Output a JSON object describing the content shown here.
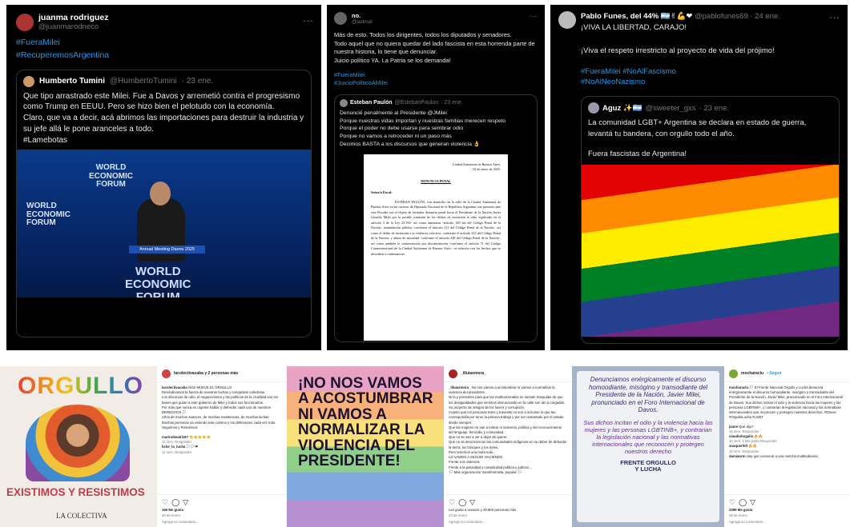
{
  "t1": {
    "name": "juanma rodriguez",
    "handle": "@juanmarodneco",
    "tags": [
      "#FueraMilei",
      "#RecuperemosArgentina"
    ],
    "q": {
      "name": "Humberto Tumini",
      "handle": "@HumbertoTumini",
      "date": "· 23 ene.",
      "text": "Que tipo arrastrado este Milei. Fue a Davos y arremetió contra el progresismo como Trump en EEUU. Pero se hizo bien el pelotudo con la economía.\nClaro, que va a decir, acá abrimos las importaciones para destruir la industria y su jefe allá le pone aranceles a todo.\n#Lamebotas",
      "img": {
        "wef1": "WORLD\nECONOMIC\nFORUM",
        "wef2": "WORLD\nECONOMIC\nFORUM",
        "wef3": "WORLD\nECONOMIC\nFORUM",
        "banner": "Annual Meeting Davos 2025"
      }
    }
  },
  "t2": {
    "name": "no.",
    "handle": "@iadmal",
    "text": "Más de esto. Todos los dirigentes, todos los diputados y senadores.\nTodo aquel que no quiera quedar del lado fascista en esta horrenda parte de nuestra historia, lo tiene que denunciar.\nJuicio político YA. La Patria se los demanda!",
    "tags": [
      "#FueraMilei",
      "#JuicioPoliticoAMilei"
    ],
    "q": {
      "name": "Esteban Paulón",
      "handle": "@EstebanPaulon",
      "date": "· 23 ene.",
      "text": "Denuncié penalmente al Presidente @JMilei\nPorque nuestras vidas importan y nuestras familias merecen respeto\nPorque el poder no debe usarse para sembrar odio\nPorque no vamos a retroceder ni un paso más\nDecimos BASTA a los discursos que generan violencia 👌",
      "doc": {
        "place": "Ciudad Autónoma de Buenos Aires,\n23 de enero de 2025.",
        "title": "DENUNCIA PENAL",
        "salute": "Señor/a Fiscal:",
        "body": "ESTEBAN PAULÓN, con domicilio en la calle de la Ciudad Autónoma de Buenos Aires en mi carácter de Diputado Nacional de la República Argentina, me presento ante esta Fiscalía con el objeto de formular denuncia penal hacia el Presidente de la Nación Javier Gerardo Milei por la posible comisión de los delitos de incitación al odio -tipificado en el artículo 3 de la Ley 23.592- así como amenazas -artículo 149 bis del Código Penal de la Nación-, intimidación pública -conforme el artículo 211 del Código Penal de la Nación-, así como el delito de incitación a la violencia colectiva -conforme el artículo 212 del Código Penal de la Nación- y abuso de autoridad -conforme el artículo 248 del Código Penal de la Nación-, así como también la contravención por discriminación -conforme el artículo 71 del Código Contravencional de la Ciudad Autónoma de Buenos Aires-, en relación con los hechos que se describen a continuación."
      }
    }
  },
  "t3": {
    "name": "Pablo Funes, del 44% 🇦🇷✌💪❤",
    "handle": "@pablofunes69",
    "date": "· 24 ene.",
    "l1": "¡VIVA LA LIBERTAD, CARAJO!",
    "l2": "¡Viva el respeto irrestricto al proyecto de vida del prójimo!",
    "tags": [
      "#FueraMilei #NoAlFascismo",
      "#NoAlNeoNazismo"
    ],
    "q": {
      "name": "Aguz ✨🇦🇷",
      "handle": "@sweeter_gxs",
      "date": "· 23 ene.",
      "text": "La comunidad LGBT+ Argentina se declara en estado de guerra, levantá tu bandera, con orgullo todo el año.",
      "text2": "Fuera fascistas de Argentina!"
    }
  },
  "ig1": {
    "title": "ORGULLO",
    "sub": "EXISTIMOS Y RESISTIMOS",
    "brand": "LA COLECTIVA"
  },
  "ig1r": {
    "user": "lacolectivacaba y 2 personas más",
    "cap_user": "lacolectivacaba",
    "cap": "NOS MUEVE EL ORGULLO",
    "body": [
      "Reivindicamos la fuerza de nuestras luchas y conquistas colectivas.",
      "Los discursos de odio, el negacionismo y las políticas de la crueldad son los bases que guían a este gobierno de Milei y todos sus funcionarios.",
      "Por más que nunca es urgente hablar y defender cada uno de nuestros DERECHOS 🏳",
      "Años de muchos avances, de muchas resistencias, de muchas luchas.",
      "Muchas personas ya viviendo este camino y los defensores cada vez más.",
      "Seguimos y Resistimos"
    ],
    "c1u": "marinobeatriz67",
    "c1": "👏👏👏👏👏",
    "c1m": "11 sem.  Responder",
    "c2u": "liche_la_lucha",
    "c2": "🏳🏳❤",
    "c2m": "11 sem.  Responder",
    "likes": "166 Me gusta",
    "ago": "28 de enero",
    "add": "Agrega un comentario..."
  },
  "ig2": {
    "text": "¡NO NOS VAMOS A ACOSTUMBRAR NI VAMOS A NORMALIZAR LA VIOLENCIA DEL PRESIDENTE!"
  },
  "ig2r": {
    "user": "_illuiasmora_",
    "cap_user": "_illuiasmora_",
    "body": [
      "No nos vamos a acostumbrar ni vamos a normalizar la violencia del presidente.",
      "Ni la y presentes para que las multinacionales se sientan tranquilas de que los desigualdades que venimos denunciando en la calle son tan a cargadas.",
      "Su proyecto de amigos de los lovers y corrupción.",
      "Cuanto que los personas trans y travestis no son a incluirse lo que lao correspondía por tener la primera trabajo y por ser restantado por el estado desde siempre.",
      "Que las mujeres no van a tolerar ni violencia, politica y del reconocimiento del lenguaje, femicidio y comunidad.",
      "Que no se van a ver a dejar de querer.",
      "Que no se desconozcan las comunidades indígenas en su deber de defender la tierra, los bosques y los rieles.",
      "Pero tenemos una meta sola...",
      "LO VAMOS A SEGUIR HACIENDO",
      "Frente a la violencia",
      "Frente a la pasividad y complicidad política y judicial...",
      "🏳 Mas organización transfeminista, popular 🏳"
    ],
    "likes": "Les gusta a xxxxxxx y 20.803 personas más",
    "ago": "23 de enero",
    "add": "Agrega un comentario..."
  },
  "ig3": {
    "text": "Denunciamos enérgicamente el discurso homoodiante, misógino y transodiante del Presidente de la Nación, Javier Milei, pronunciado en el Foro Internacional de Davos.",
    "text2": "Sus dichos incitan el odio y la violencia hacia las mujeres y las personas LGBTINB+, y contrarian la legislación nacional y las normativas internacionales que reconocen y protegen nuestros derecho",
    "brand": "FRENTE ORGULLO Y LUCHA"
  },
  "ig3r": {
    "user": "mocharaclu",
    "follow": "• Seguir",
    "cap_user": "mocharaclu",
    "cap": "🏳 El Frente Nacional Orgullo y Lucha denuncia enérgicamente el discurso homoodiante, misógino y transodiante del Presidente de la Nación, Javier Milei, pronunciado en el Foro Internacional de Davos. Sus dichos incitan el odio y la violencia hacia las mujeres y las personas LGBTINB+, y contrarian la legislación nacional y las normativas internacionales que reconocen y protegen nuestros derechos. #Davos #OrgulloLucha #LGBT",
    "cm": [
      {
        "u": "jiame",
        "t": "Qué dijo?",
        "m": "15 sem.  Responder"
      },
      {
        "u": "claudiohogalix",
        "t": "🔥🔥",
        "m": "15 sem.  1 Me gusta  Responder"
      },
      {
        "u": "anaquerfell",
        "t": "🔥🔥",
        "m": "15 sem.  Responder"
      },
      {
        "u": "damianrm",
        "t": "Hay que convocar a una marcha multitudinaria",
        "m": ""
      }
    ],
    "likes": "2399 Me gusta",
    "ago": "28 de enero",
    "add": "Agrega un comentario..."
  }
}
